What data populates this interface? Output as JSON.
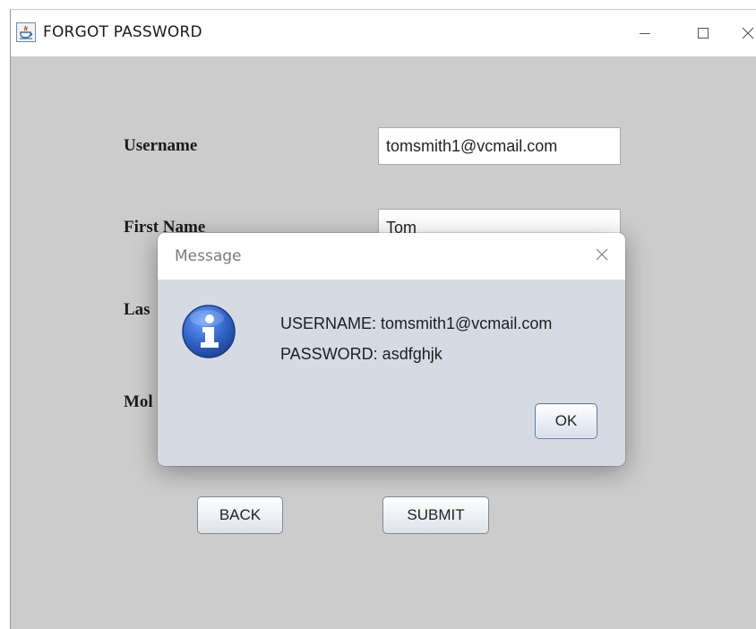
{
  "window": {
    "title": "FORGOT PASSWORD",
    "icons": {
      "app": "java-app-icon",
      "minimize": "minimize-icon",
      "maximize": "maximize-icon",
      "close": "close-icon"
    }
  },
  "form": {
    "username_label": "Username",
    "username_value": "tomsmith1@vcmail.com",
    "first_name_label": "First Name",
    "first_name_value": "Tom",
    "last_name_label_partial": "Las",
    "mobile_label_partial": "Mol",
    "back_button": "BACK",
    "submit_button": "SUBMIT"
  },
  "dialog": {
    "title": "Message",
    "icon": "info-icon",
    "line1": "USERNAME: tomsmith1@vcmail.com",
    "line2": "PASSWORD: asdfghjk",
    "ok_button": "OK"
  },
  "colors": {
    "window_bg": "#cccccc",
    "dialog_bg": "#d6dae2",
    "info_icon": "#2f64c6"
  }
}
